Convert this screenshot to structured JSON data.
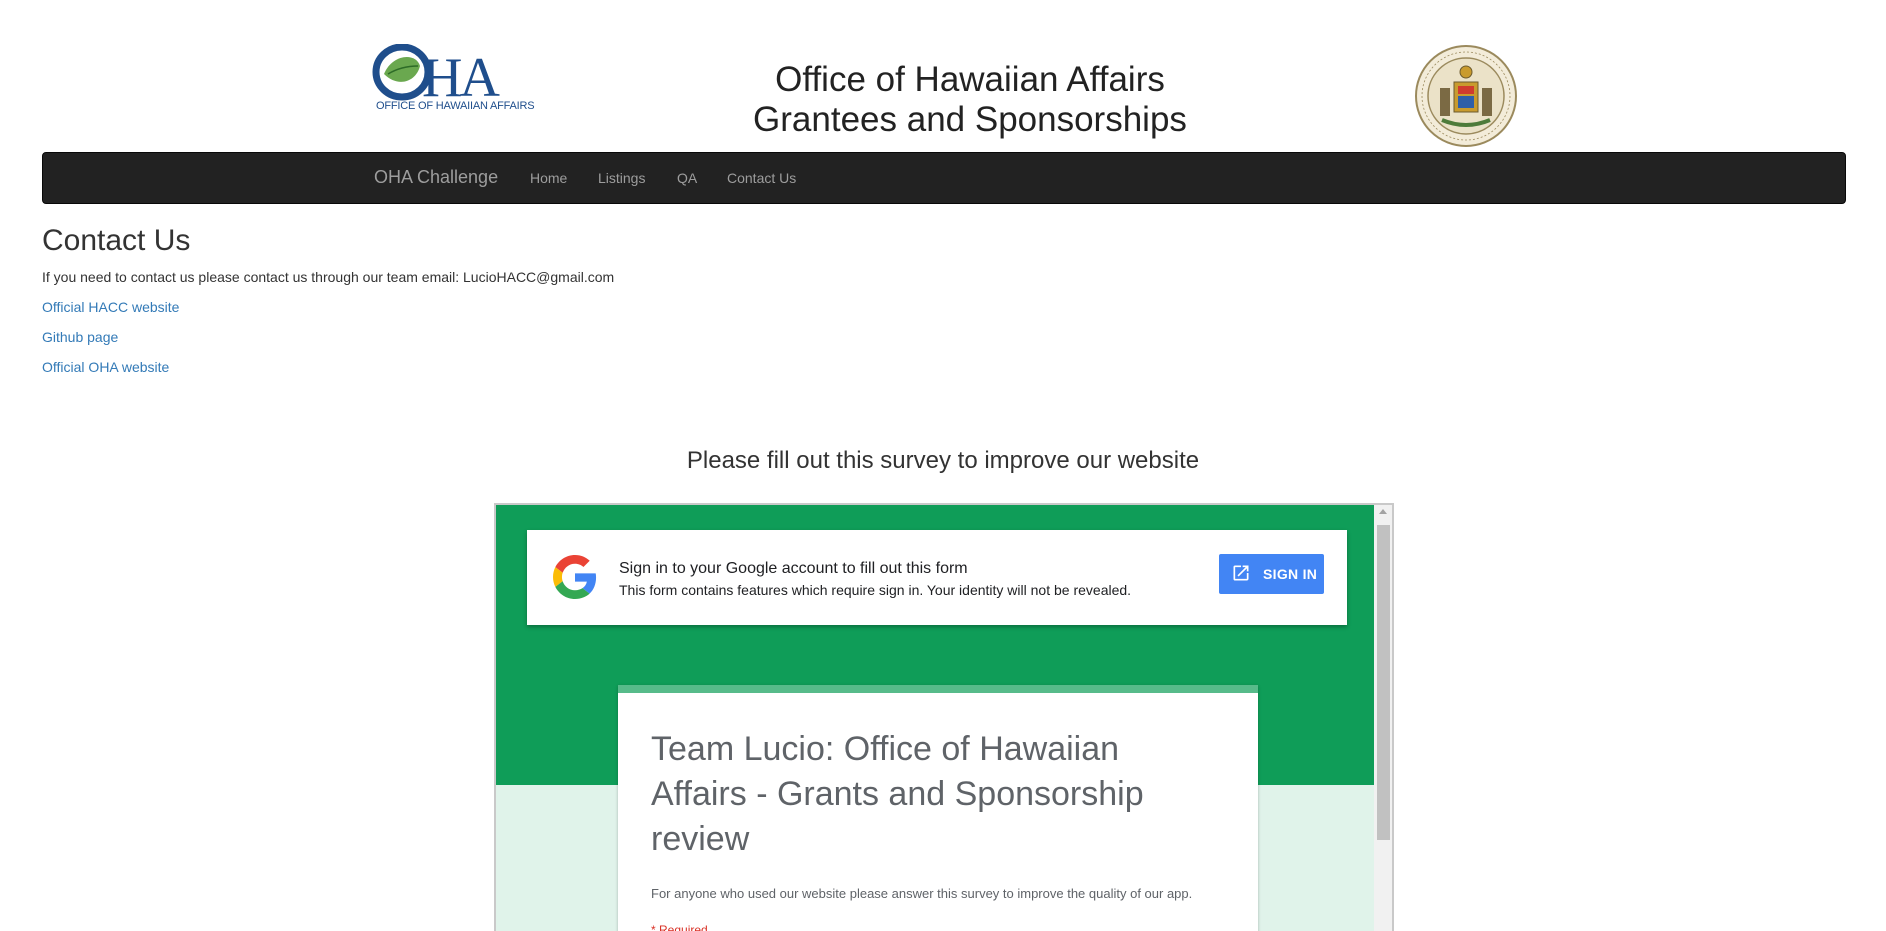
{
  "header": {
    "logo_main": "OHA",
    "logo_caption": "OFFICE OF HAWAIIAN AFFAIRS",
    "title_line1": "Office of Hawaiian Affairs",
    "title_line2": "Grantees and Sponsorships",
    "seal_icon": "state-of-hawaii-seal"
  },
  "navbar": {
    "brand": "OHA Challenge",
    "links": [
      "Home",
      "Listings",
      "QA",
      "Contact Us"
    ],
    "colors": {
      "background": "#222222",
      "text": "#9d9d9d"
    }
  },
  "contact": {
    "heading": "Contact Us",
    "intro": "If you need to contact us please contact us through our team email: LucioHACC@gmail.com",
    "links": [
      "Official HACC website",
      "Github page",
      "Official OHA website"
    ],
    "link_color": "#337ab7"
  },
  "survey": {
    "heading": "Please fill out this survey to improve our website",
    "signin_title": "Sign in to your Google account to fill out this form",
    "signin_subtitle": "This form contains features which require sign in. Your identity will not be revealed.",
    "signin_button": "SIGN IN",
    "form_title": "Team Lucio: Office of Hawaiian Affairs - Grants and Sponsorship review",
    "form_description": "For anyone who used our website please answer this survey to improve the quality of our app.",
    "required_note": "* Required",
    "colors": {
      "band": "#0f9d58",
      "button": "#4285f4",
      "accent": "#57bb8a"
    }
  }
}
